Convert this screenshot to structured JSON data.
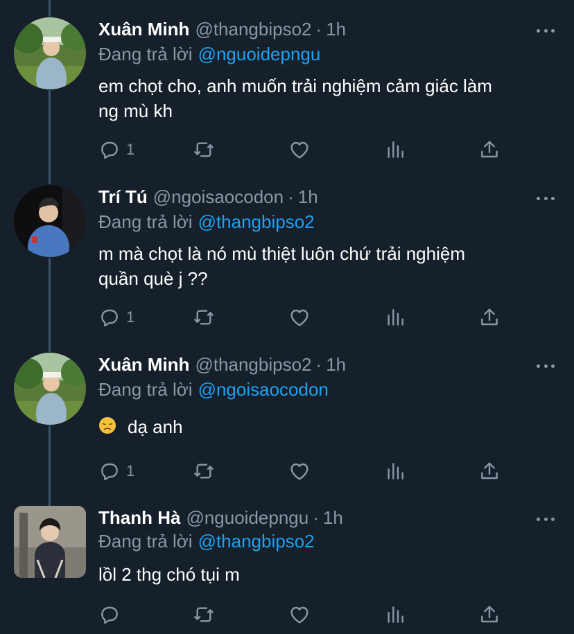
{
  "colors": {
    "background": "#15202b",
    "text": "#ffffff",
    "secondary": "#8899a6",
    "link": "#1da1f2",
    "thread_line": "#3d5466"
  },
  "tweets": [
    {
      "name": "Xuân Minh",
      "handle": "@thangbipso2",
      "dot": "·",
      "time": "1h",
      "replying_label": "Đang trả lời",
      "replying_to": "@nguoidepngu",
      "text_lines": [
        "em chọt cho, anh muốn trải nghiệm cảm giác làm",
        "ng mù kh"
      ],
      "reply_count": "1",
      "avatar_icon": "avatar-photo-outdoor"
    },
    {
      "name": "Trí Tú",
      "handle": "@ngoisaocodon",
      "dot": "·",
      "time": "1h",
      "replying_label": "Đang trả lời",
      "replying_to": "@thangbipso2",
      "text_lines": [
        "m mà chọt là nó mù thiệt luôn chứ trải nghiệm",
        "quần què j ??"
      ],
      "reply_count": "1",
      "avatar_icon": "avatar-photo-dark"
    },
    {
      "name": "Xuân Minh",
      "handle": "@thangbipso2",
      "dot": "·",
      "time": "1h",
      "replying_label": "Đang trả lời",
      "replying_to": "@ngoisaocodon",
      "emoji_icon": "disappointed-face-emoji",
      "text_lines": [
        "dạ anh"
      ],
      "reply_count": "1",
      "avatar_icon": "avatar-photo-outdoor"
    },
    {
      "name": "Thanh Hà",
      "handle": "@nguoidepngu",
      "dot": "·",
      "time": "1h",
      "replying_label": "Đang trả lời",
      "replying_to": "@thangbipso2",
      "text_lines": [
        "lồl 2 thg chó tụi m"
      ],
      "reply_count": "",
      "avatar_icon": "avatar-photo-street"
    }
  ]
}
